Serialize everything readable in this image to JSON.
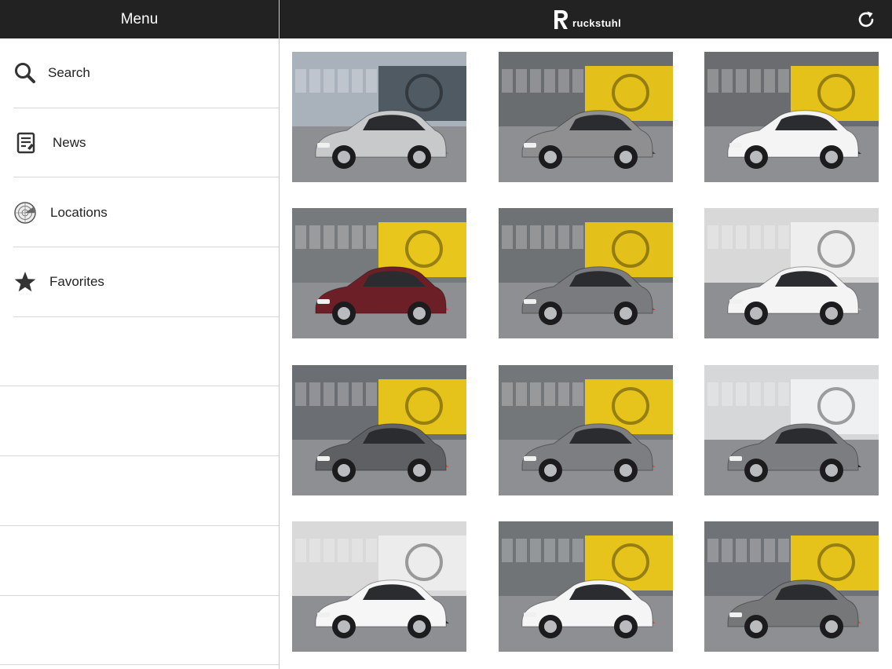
{
  "sidebar": {
    "title": "Menu",
    "items": [
      {
        "label": "Search",
        "icon": "search-icon"
      },
      {
        "label": "News",
        "icon": "news-icon"
      },
      {
        "label": "Locations",
        "icon": "radar-icon"
      },
      {
        "label": "Favorites",
        "icon": "star-icon"
      }
    ]
  },
  "header": {
    "brand": "ruckstuhl",
    "refresh_icon": "refresh-icon"
  },
  "gallery": {
    "tiles": [
      {
        "bg": "#a9b2bb",
        "building": "#4f5a62",
        "car": "#c8c9cb",
        "accent": "#6f7c86"
      },
      {
        "bg": "#6a6d70",
        "building": "#e4c11a",
        "car": "#8f8f92",
        "accent": "#3b3c40"
      },
      {
        "bg": "#6b6c6f",
        "building": "#e5c21a",
        "car": "#f4f4f4",
        "accent": "#2b2b2e"
      },
      {
        "bg": "#777a7d",
        "building": "#e8c61c",
        "car": "#6c1f26",
        "accent": "#d94a3a"
      },
      {
        "bg": "#6f7275",
        "building": "#e4c11a",
        "car": "#7a7b7e",
        "accent": "#c9303a"
      },
      {
        "bg": "#d8d8d8",
        "building": "#eeeeee",
        "car": "#f4f4f4",
        "accent": "#b9c0c4"
      },
      {
        "bg": "#6b6e72",
        "building": "#e6c31b",
        "car": "#5f6063",
        "accent": "#d84a3b"
      },
      {
        "bg": "#74777a",
        "building": "#e7c41c",
        "car": "#7d7e81",
        "accent": "#d84a3b"
      },
      {
        "bg": "#d5d7d9",
        "building": "#eef0f1",
        "car": "#7c7d80",
        "accent": "#1b1b1c"
      },
      {
        "bg": "#d9d9d9",
        "building": "#ececec",
        "car": "#f6f6f6",
        "accent": "#1a1a1b"
      },
      {
        "bg": "#717477",
        "building": "#e7c41c",
        "car": "#f5f5f5",
        "accent": "#d84a3b"
      },
      {
        "bg": "#6f7276",
        "building": "#e6c31b",
        "car": "#767779",
        "accent": "#d84a3b"
      }
    ]
  }
}
